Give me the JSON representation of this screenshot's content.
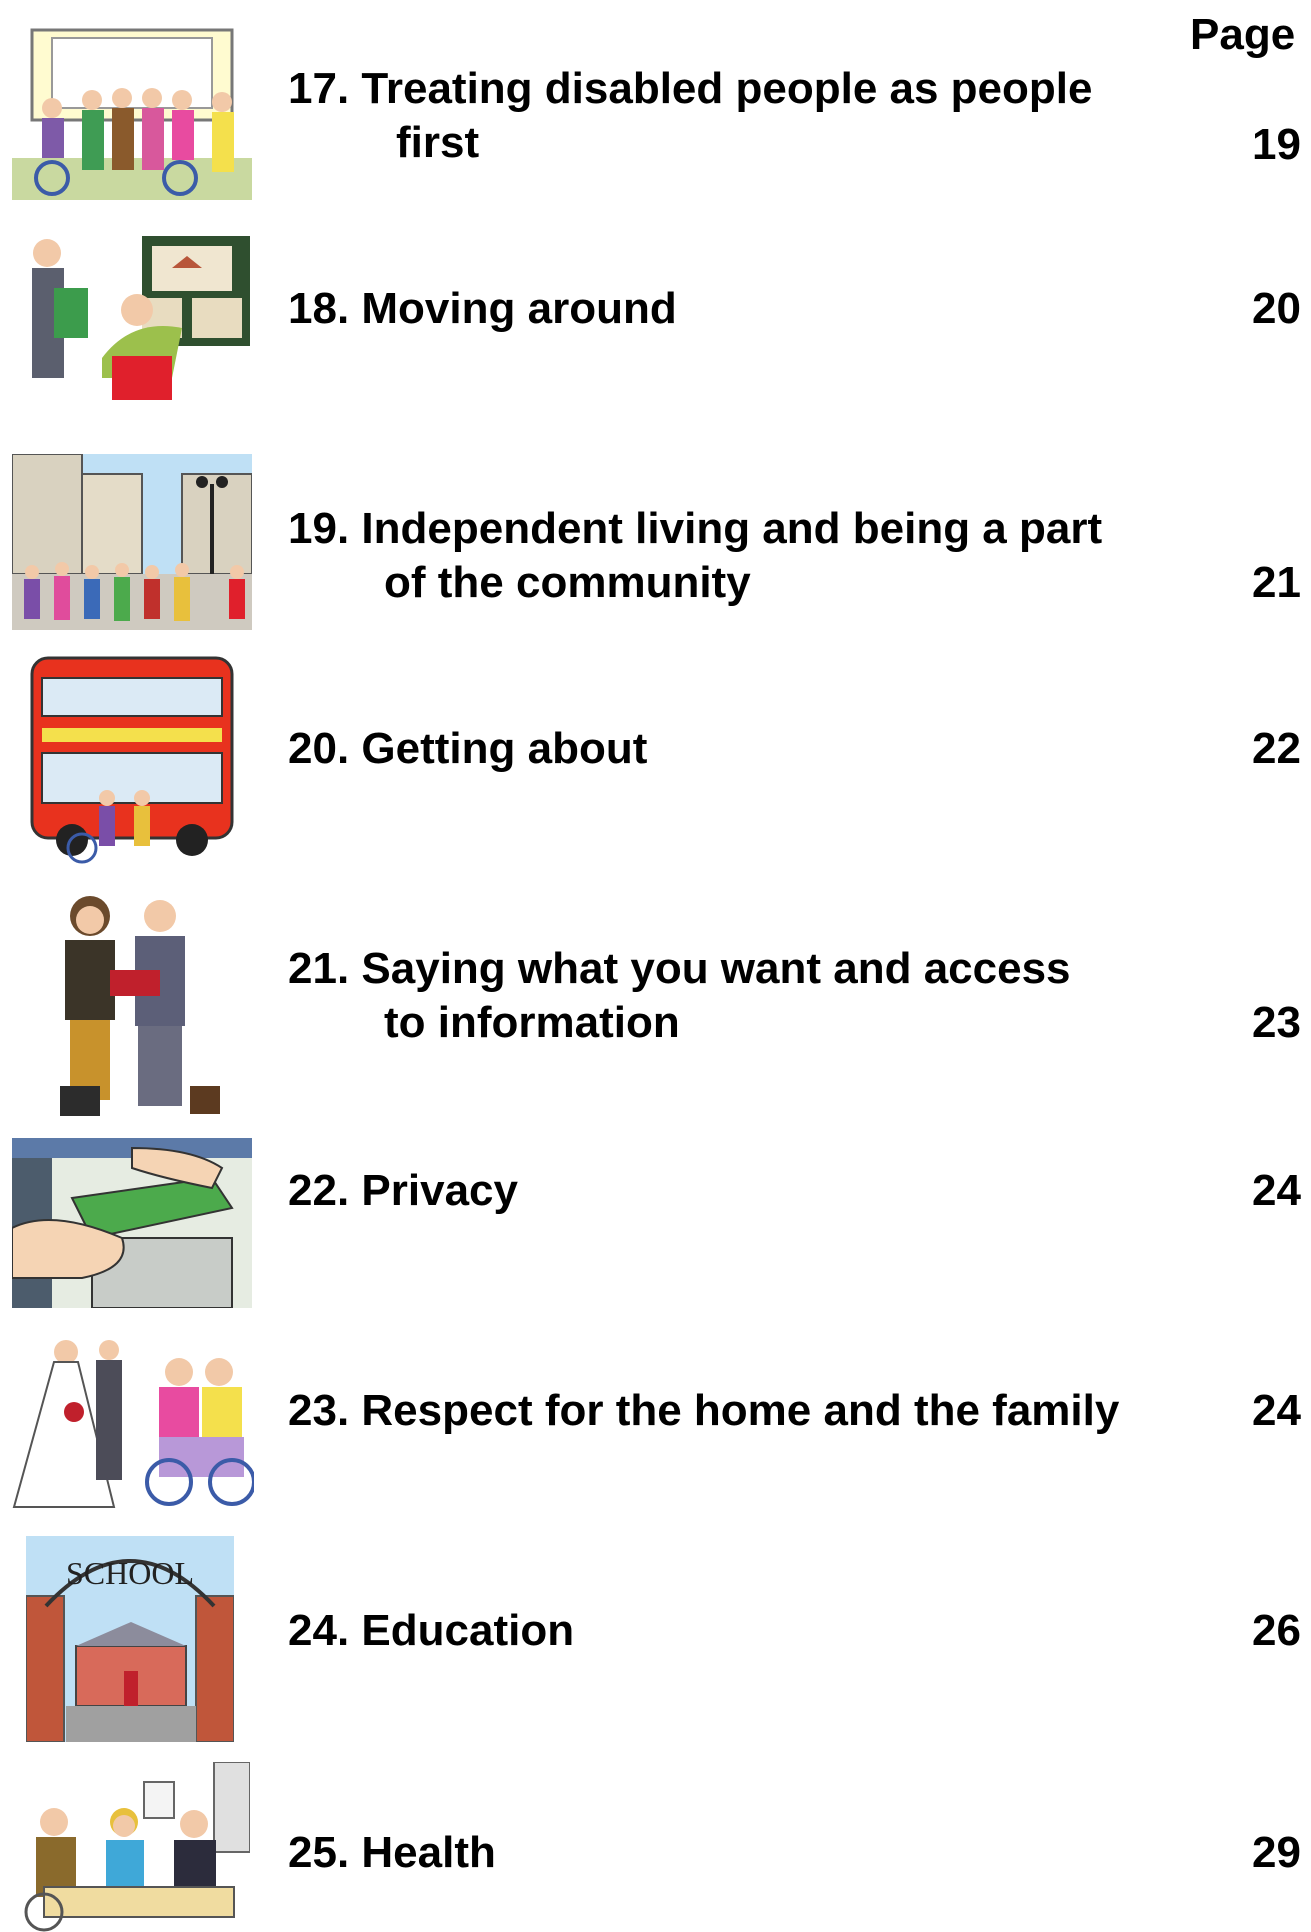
{
  "header": {
    "page_label": "Page"
  },
  "entries": [
    {
      "number": "17.",
      "line1": "Treating disabled people as people",
      "line2": "first",
      "page": "19",
      "picture": "disabled-people-group-picture"
    },
    {
      "number": "18.",
      "line1": "Moving around",
      "line2": "",
      "page": "20",
      "picture": "house-pictures-board-picture"
    },
    {
      "number": "19.",
      "line1": "Independent living and being a part",
      "line2": "of the community",
      "page": "21",
      "picture": "busy-street-picture"
    },
    {
      "number": "20.",
      "line1": "Getting about",
      "line2": "",
      "page": "22",
      "picture": "red-bus-picture"
    },
    {
      "number": "21.",
      "line1": "Saying what you want and access",
      "line2": "to information",
      "page": "23",
      "picture": "two-people-reading-picture"
    },
    {
      "number": "22.",
      "line1": "Privacy",
      "line2": "",
      "page": "24",
      "picture": "letterbox-picture"
    },
    {
      "number": "23.",
      "line1": "Respect for the home and the family",
      "line2": "",
      "page": "24",
      "picture": "wedding-and-couple-picture"
    },
    {
      "number": "24.",
      "line1": "Education",
      "line2": "",
      "page": "26",
      "picture": "school-gate-picture"
    },
    {
      "number": "25.",
      "line1": "Health",
      "line2": "",
      "page": "29",
      "picture": "doctor-appointment-picture"
    }
  ],
  "colors": {
    "bus_red": "#e8321e",
    "brick": "#c0563a",
    "sky": "#bfe0f5"
  }
}
